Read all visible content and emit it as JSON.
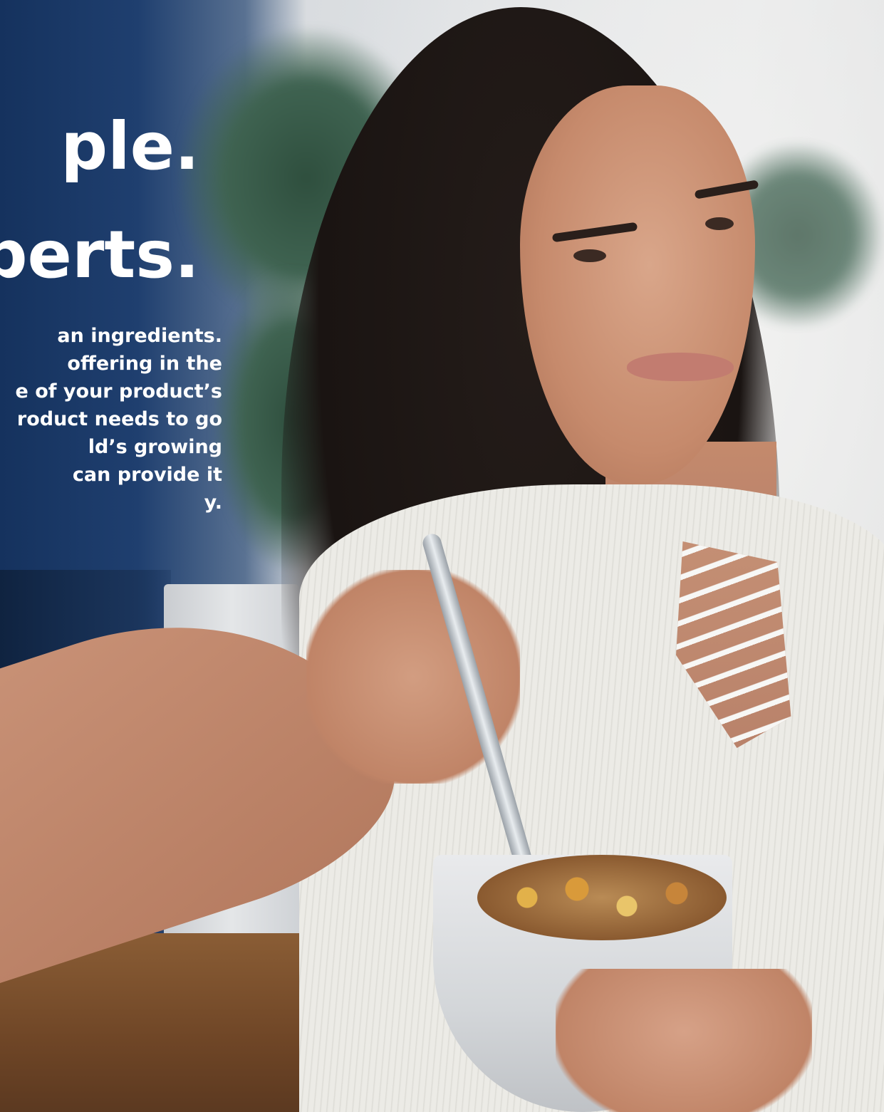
{
  "image": {
    "subject": "woman eating cereal",
    "palette": {
      "accent_blue": "#1f3f6f",
      "text": "#ffffff"
    }
  },
  "headline": {
    "line1": "ple.",
    "line2": "perts."
  },
  "body": {
    "lines": [
      "an ingredients.",
      "offering in the",
      "e of your product’s",
      "roduct needs to go",
      "ld’s growing",
      "can provide it",
      "y."
    ]
  }
}
